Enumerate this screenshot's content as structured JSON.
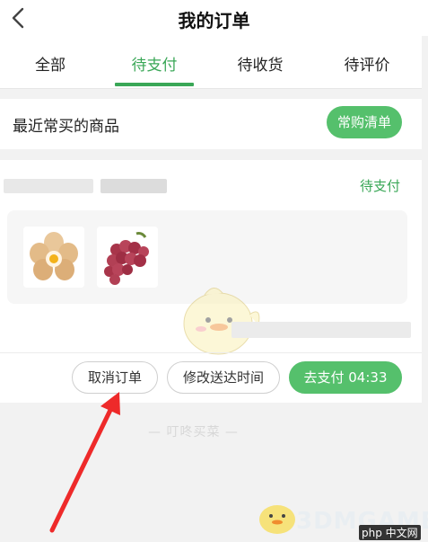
{
  "header": {
    "title": "我的订单",
    "back_icon": "back-arrow-icon"
  },
  "tabs": [
    {
      "label": "全部",
      "active": false
    },
    {
      "label": "待支付",
      "active": true
    },
    {
      "label": "待收货",
      "active": false
    },
    {
      "label": "待评价",
      "active": false
    }
  ],
  "recent": {
    "title": "最近常买的商品",
    "button_label": "常购清单"
  },
  "order": {
    "status": "待支付",
    "products": [
      {
        "name_icon": "eggs-image"
      },
      {
        "name_icon": "grapes-image"
      }
    ],
    "actions": {
      "cancel_label": "取消订单",
      "modify_label": "修改送达时间",
      "pay_label": "去支付 04:33"
    }
  },
  "colors": {
    "accent": "#3aa757",
    "button_green": "#55c06c",
    "annotation_red": "#ee2a2a"
  },
  "watermarks": {
    "brand": "— 叮咚买菜 —",
    "site": "3DMGAME",
    "site2": "php 中文网"
  }
}
